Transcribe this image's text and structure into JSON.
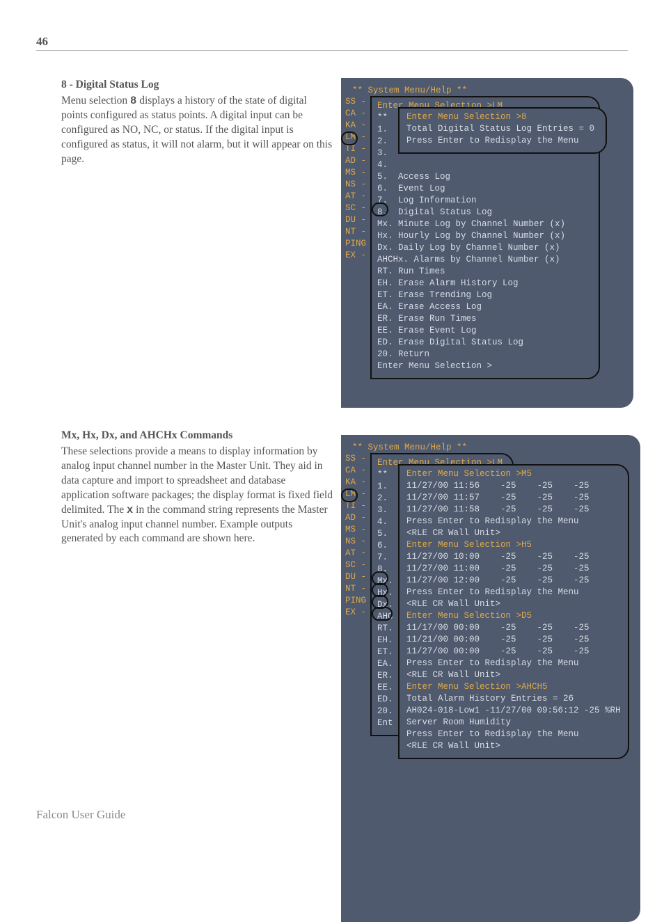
{
  "page_number": "46",
  "footer": "Falcon User Guide",
  "section1": {
    "title": "8 - Digital Status Log",
    "body_pre": "Menu selection ",
    "body_bold": "8",
    "body_post": " displays a history of the state of digital points configured as status points.  A digital input can be configured as NO, NC, or status.  If the digital input is configured as status, it will not alarm, but it will appear on this page."
  },
  "section2": {
    "title": "Mx, Hx, Dx, and AHCHx Commands",
    "body_pre": "These selections provide a means to display information by analog input channel number in the Master Unit.  They aid in data capture and import to spreadsheet and database application software packages; the display format is fixed field delimited.  The ",
    "body_bold": "x",
    "body_post": " in the command string represents the Master Unit's analog input channel number.  Example outputs generated by each command are shown here."
  },
  "term_header": "** System Menu/Help **",
  "side_codes_1": "SS -\nCA -\nKA -\nLM -\nTI -\nAD -\nMS -\nNS -\nAT -\nSC -\nDU -\nNT -\nPING\nEX -",
  "side_codes_2": "SS -\nCA -\nKA -\nLM -\nTI -\nAD -\nMS -\nNS -\nAT -\nSC -\nDU -\nNT -\nPING\nEX -",
  "mid1": {
    "l0": "Enter Menu Selection >LM",
    "l1": "**",
    "l2": "1.",
    "l3": "2.",
    "l4": "3.",
    "l5": "4.",
    "l6": "5.  Access Log",
    "l7": "6.  Event Log",
    "l8": "7.  Log Information",
    "l9": "8.  Digital Status Log",
    "l10": "Mx. Minute Log by Channel Number (x)",
    "l11": "Hx. Hourly Log by Channel Number (x)",
    "l12": "Dx. Daily Log by Channel Number (x)",
    "l13": "AHCHx. Alarms by Channel Number (x)",
    "l14": "RT. Run Times",
    "l15": "EH. Erase Alarm History Log",
    "l16": "ET. Erase Trending Log",
    "l17": "EA. Erase Access Log",
    "l18": "ER. Erase Run Times",
    "l19": "EE. Erase Event Log",
    "l20": "ED. Erase Digital Status Log",
    "l21": "20. Return",
    "l22": "Enter Menu Selection >"
  },
  "inner1": {
    "l0": "Enter Menu Selection >8",
    "l1": "",
    "l2": "Total Digital Status Log Entries = 0",
    "l3": "Press Enter to Redisplay the Menu"
  },
  "mid2": {
    "l0": "Enter Menu Selection >LM",
    "l1": "**",
    "l2": "1.",
    "l3": "2.",
    "l4": "3.",
    "l5": "4.",
    "l6": "5.",
    "l7": "6.",
    "l8": "7.",
    "l9": "8.",
    "l10": "Mx.",
    "l11": "Hx.",
    "l12": "Dx.",
    "l13": "AHC",
    "l14": "RT.",
    "l15": "EH.",
    "l16": "ET.",
    "l17": "EA.",
    "l18": "ER.",
    "l19": "EE.",
    "l20": "ED.",
    "l21": "20.",
    "l22": "Ent"
  },
  "inner2": {
    "r": [
      "Enter Menu Selection >M5",
      "11/27/00 11:56    -25    -25    -25",
      "11/27/00 11:57    -25    -25    -25",
      "11/27/00 11:58    -25    -25    -25",
      "Press Enter to Redisplay the Menu",
      "<RLE CR Wall Unit>",
      "Enter Menu Selection >H5",
      "11/27/00 10:00    -25    -25    -25",
      "11/27/00 11:00    -25    -25    -25",
      "11/27/00 12:00    -25    -25    -25",
      "Press Enter to Redisplay the Menu",
      "<RLE CR Wall Unit>",
      "Enter Menu Selection >D5",
      "11/17/00 00:00    -25    -25    -25",
      "11/21/00 00:00    -25    -25    -25",
      "11/27/00 00:00    -25    -25    -25",
      "Press Enter to Redisplay the Menu",
      "<RLE CR Wall Unit>",
      "Enter Menu Selection >AHCH5",
      "Total Alarm History Entries = 26",
      "AH024-018-Low1 -11/27/00 09:56:12 -25 %RH",
      "Server Room Humidity",
      "Press Enter to Redisplay the Menu",
      "<RLE CR Wall Unit>"
    ]
  }
}
